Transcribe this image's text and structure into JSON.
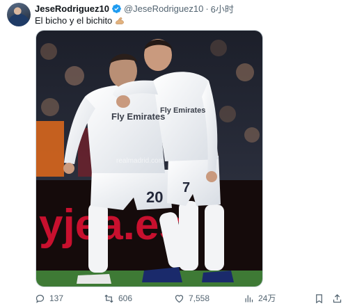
{
  "tweet": {
    "display_name": "JeseRodriguez10",
    "handle": "@JeseRodriguez10",
    "separator": "·",
    "time": "6小时",
    "text": "El bicho y el bichito",
    "emoji_icon": "flexed-biceps-icon",
    "verified_color": "#1d9bf0"
  },
  "media": {
    "description_alt": "",
    "jersey_sponsor": "Fly Emirates",
    "jersey_numbers": [
      "20",
      "7"
    ],
    "watermark": "realmadrid.com",
    "board_text": "yjea.es"
  },
  "actions": {
    "reply_count": "137",
    "retweet_count": "606",
    "like_count": "7,558",
    "views_count": "24万"
  },
  "colors": {
    "text_primary": "#0f1419",
    "text_secondary": "#536471",
    "board_red": "#c8102e",
    "pitch_green": "#3e7a35"
  }
}
